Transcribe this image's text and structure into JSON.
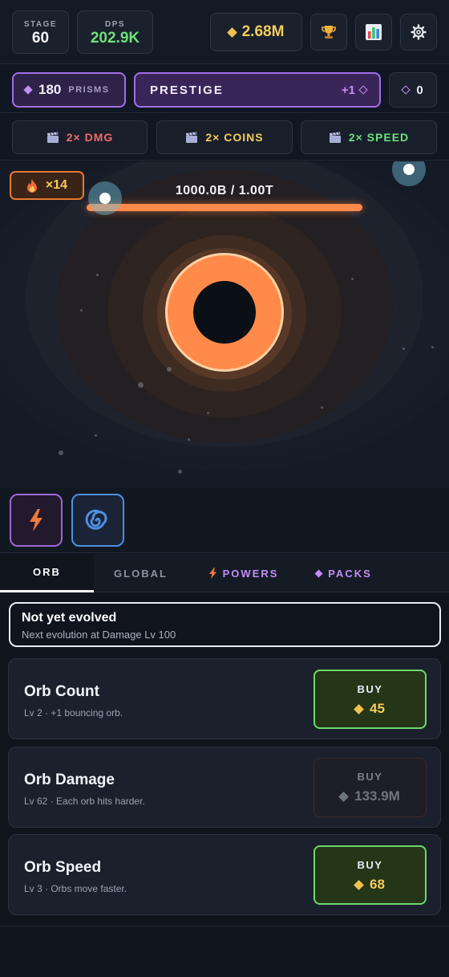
{
  "header": {
    "stage_label": "STAGE",
    "stage_value": "60",
    "dps_label": "DPS",
    "dps_value": "202.9K",
    "coins": "2.68M"
  },
  "prestige": {
    "prisms_value": "180",
    "prisms_label": "PRISMS",
    "button_label": "PRESTIGE",
    "gain": "+1",
    "prism_count": "0"
  },
  "boosts": [
    {
      "label": "2× DMG"
    },
    {
      "label": "2× COINS"
    },
    {
      "label": "2× SPEED"
    }
  ],
  "game": {
    "combo": "×14",
    "hp_text": "1000.0B / 1.00T",
    "hp_fraction": 1.0
  },
  "tabs": [
    {
      "label": "ORB",
      "active": true
    },
    {
      "label": "GLOBAL"
    },
    {
      "label": "POWERS"
    },
    {
      "label": "PACKS"
    }
  ],
  "evolution": {
    "title": "Not yet evolved",
    "subtitle": "Next evolution at Damage Lv 100"
  },
  "upgrades": [
    {
      "name": "Orb Count",
      "desc": "Lv 2 · +1 bouncing orb.",
      "buy": "BUY",
      "price": "45",
      "affordable": true
    },
    {
      "name": "Orb Damage",
      "desc": "Lv 62 · Each orb hits harder.",
      "buy": "BUY",
      "price": "133.9M",
      "affordable": false
    },
    {
      "name": "Orb Speed",
      "desc": "Lv 3 · Orbs move faster.",
      "buy": "BUY",
      "price": "68",
      "affordable": true
    }
  ],
  "colors": {
    "coin": "#f5cc5a",
    "prism": "#c48df5",
    "dps": "#6fe07b",
    "target": "#ff8a4a"
  },
  "icons": {
    "trophy": "trophy-icon",
    "stats": "bar-chart-icon",
    "settings": "gear-icon",
    "boost": "clapperboard-icon",
    "combo": "flame-icon",
    "power1": "lightning-icon",
    "power2": "vortex-icon"
  }
}
